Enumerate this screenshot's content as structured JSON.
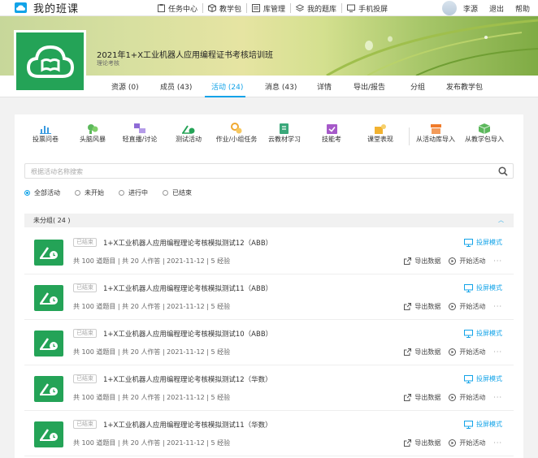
{
  "app": {
    "title": "我的班课"
  },
  "topnav": [
    {
      "label": "任务中心",
      "icon": "task-icon"
    },
    {
      "label": "教学包",
      "icon": "package-icon"
    },
    {
      "label": "库管理",
      "icon": "library-icon"
    },
    {
      "label": "我的题库",
      "icon": "question-bank-icon"
    },
    {
      "label": "手机投屏",
      "icon": "phone-cast-icon"
    }
  ],
  "user": {
    "name": "李源",
    "logout": "退出",
    "help": "帮助"
  },
  "course": {
    "title": "2021年1+X工业机器人应用编程证书考核培训班",
    "subtitle": "理论考核"
  },
  "tabs": [
    {
      "label": "资源 (0)"
    },
    {
      "label": "成员 (43)"
    },
    {
      "label": "活动 (24)"
    },
    {
      "label": "消息 (43)"
    },
    {
      "label": "详情"
    },
    {
      "label": "导出/报告"
    },
    {
      "label": "分组"
    },
    {
      "label": "发布教学包"
    }
  ],
  "tools": [
    {
      "label": "投票问卷",
      "icon": "vote-icon",
      "color": "#3a9be0"
    },
    {
      "label": "头脑风暴",
      "icon": "brainstorm-icon",
      "color": "#5cb85c"
    },
    {
      "label": "轻直播/讨论",
      "icon": "live-discuss-icon",
      "color": "#8e6bd6"
    },
    {
      "label": "测试活动",
      "icon": "test-icon",
      "color": "#24a357"
    },
    {
      "label": "作业/小组任务",
      "icon": "homework-icon",
      "color": "#f0a830"
    },
    {
      "label": "云教材学习",
      "icon": "cloud-textbook-icon",
      "color": "#3aa87a"
    },
    {
      "label": "技能考",
      "icon": "skill-exam-icon",
      "color": "#a659c9"
    },
    {
      "label": "课堂表现",
      "icon": "performance-icon",
      "color": "#f2b230"
    },
    {
      "label": "从活动库导入",
      "icon": "import-library-icon",
      "color": "#f07b2a"
    },
    {
      "label": "从教学包导入",
      "icon": "import-package-icon",
      "color": "#5cb85c"
    }
  ],
  "search": {
    "placeholder": "根据活动名称搜索"
  },
  "filters": [
    {
      "label": "全部活动"
    },
    {
      "label": "未开始"
    },
    {
      "label": "进行中"
    },
    {
      "label": "已结束"
    }
  ],
  "group": {
    "title": "未分组( 24 )"
  },
  "activities": [
    {
      "status": "已结束",
      "title": "1+X工业机器人应用编程理论考核模拟测试12（ABB）",
      "meta": "共 100 道题目  |  共 20 人作答  |  2021-11-12  |  5 经验"
    },
    {
      "status": "已结束",
      "title": "1+X工业机器人应用编程理论考核模拟测试11（ABB）",
      "meta": "共 100 道题目  |  共 20 人作答  |  2021-11-12  |  5 经验"
    },
    {
      "status": "已结束",
      "title": "1+X工业机器人应用编程理论考核模拟测试10（ABB）",
      "meta": "共 100 道题目  |  共 20 人作答  |  2021-11-12  |  5 经验"
    },
    {
      "status": "已结束",
      "title": "1+X工业机器人应用编程理论考核模拟测试12（华数）",
      "meta": "共 100 道题目  |  共 20 人作答  |  2021-11-12  |  5 经验"
    },
    {
      "status": "已结束",
      "title": "1+X工业机器人应用编程理论考核模拟测试11（华数）",
      "meta": "共 100 道题目  |  共 20 人作答  |  2021-11-12  |  5 经验"
    }
  ],
  "row_actions": {
    "project": "投屏模式",
    "export": "导出数据",
    "start": "开始活动",
    "more": "···"
  },
  "colors": {
    "accent": "#12a3e8",
    "green": "#24a357"
  }
}
